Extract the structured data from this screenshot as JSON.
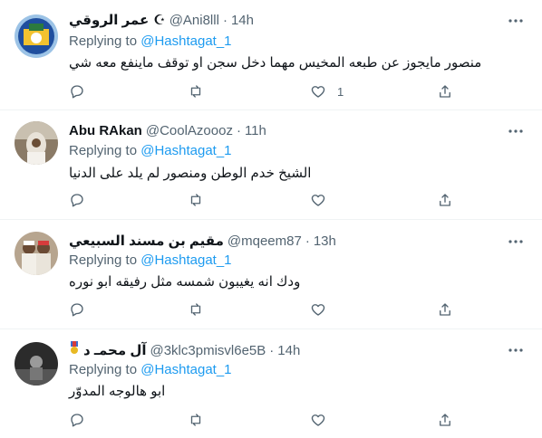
{
  "tweets": [
    {
      "name": "عمر الروقي",
      "badge": "☪",
      "handle": "@Ani8lll",
      "sep": "·",
      "time": "14h",
      "replying_prefix": "Replying to",
      "mention": "@Hashtagat_1",
      "text": "منصور مايجوز عن طبعه المخيس مهما دخل سجن او توقف ماينفع معه شي",
      "likes": "1"
    },
    {
      "name": "Abu RAkan",
      "badge": "",
      "handle": "@CoolAzoooz",
      "sep": "·",
      "time": "11h",
      "replying_prefix": "Replying to",
      "mention": "@Hashtagat_1",
      "text": "الشيخ خدم الوطن ومنصور لم يلد على الدنيا",
      "likes": ""
    },
    {
      "name": "مقيم بن مسند السبيعي",
      "badge": "",
      "handle": "@mqeem87",
      "sep": "·",
      "time": "13h",
      "replying_prefix": "Replying to",
      "mention": "@Hashtagat_1",
      "text": "ودك انه يغيبون شمسه مثل رفيقه ابو نوره",
      "likes": ""
    },
    {
      "name": "آل محمـ د",
      "badge": "🎖",
      "handle": "@3klc3pmisvl6e5B",
      "sep": "·",
      "time": "14h",
      "replying_prefix": "Replying to",
      "mention": "@Hashtagat_1",
      "text": "ابو هالوجه المدوّر",
      "likes": ""
    }
  ],
  "icons": {
    "reply": "reply-icon",
    "retweet": "retweet-icon",
    "like": "like-icon",
    "share": "share-icon",
    "more": "more-icon"
  },
  "colors": {
    "link": "#1d9bf0",
    "secondary": "#536471",
    "border": "#eff3f4",
    "text": "#0f1419"
  }
}
